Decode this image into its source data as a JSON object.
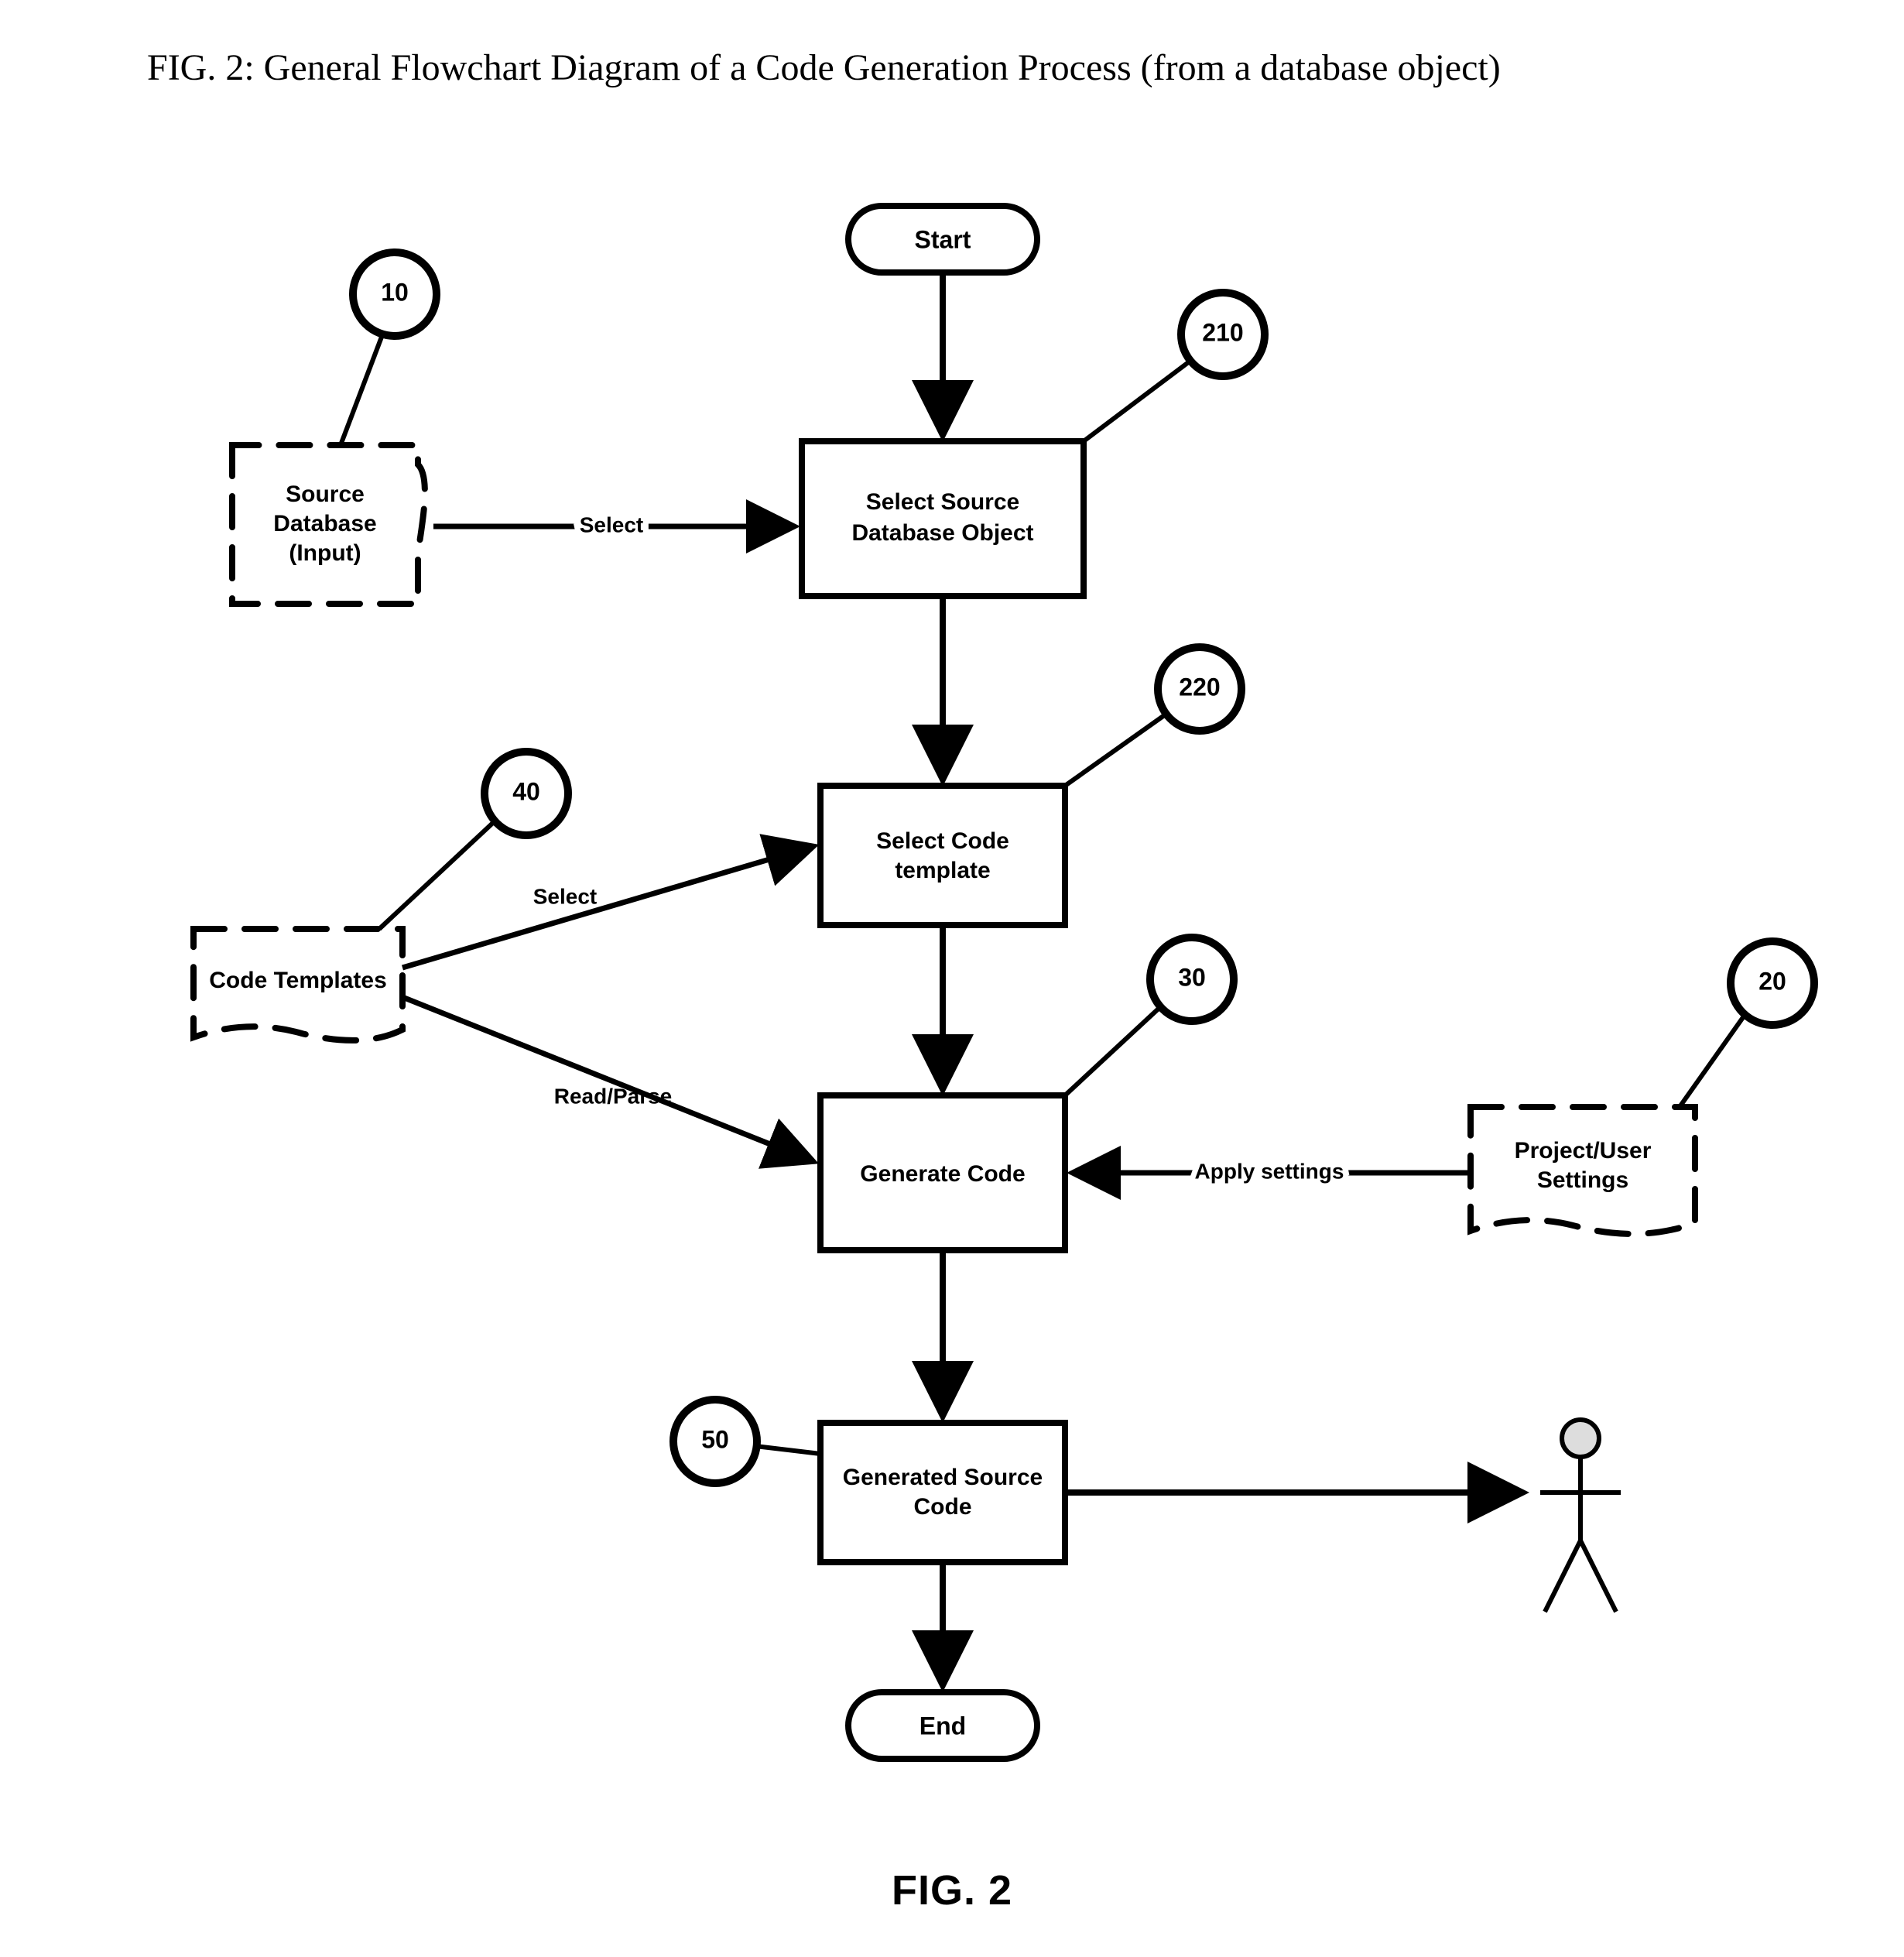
{
  "title": "FIG. 2: General Flowchart Diagram of a Code Generation Process (from a database object)",
  "figure_label": "FIG. 2",
  "terminals": {
    "start": "Start",
    "end": "End"
  },
  "processes": {
    "p210": {
      "line1": "Select Source",
      "line2": "Database Object"
    },
    "p220": {
      "line1": "Select Code",
      "line2": "template"
    },
    "p30": {
      "line1": "Generate Code"
    },
    "p50": {
      "line1": "Generated Source",
      "line2": "Code"
    }
  },
  "data_stores": {
    "d10": {
      "line1": "Source",
      "line2": "Database",
      "line3": "(Input)"
    },
    "d40": {
      "line1": "Code Templates"
    },
    "d20": {
      "line1": "Project/User",
      "line2": "Settings"
    }
  },
  "refs": {
    "r10": "10",
    "r210": "210",
    "r40": "40",
    "r220": "220",
    "r30": "30",
    "r20": "20",
    "r50": "50"
  },
  "edges": {
    "select1": "Select",
    "select2": "Select",
    "read_parse": "Read/Parse",
    "apply": "Apply settings"
  }
}
